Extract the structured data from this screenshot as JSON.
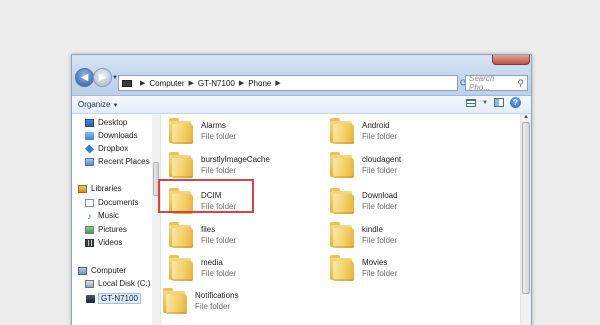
{
  "window": {
    "address_path": [
      "Computer",
      "GT-N7100",
      "Phone"
    ],
    "search_placeholder": "Search Pho..."
  },
  "toolbar": {
    "organize_label": "Organize"
  },
  "nav": {
    "favorites": [
      "Desktop",
      "Downloads",
      "Dropbox",
      "Recent Places"
    ],
    "libraries_header": "Libraries",
    "libraries": [
      "Documents",
      "Music",
      "Pictures",
      "Videos"
    ],
    "computer_header": "Computer",
    "computer_items": [
      "Local Disk (C:)",
      "GT-N7100"
    ]
  },
  "folders": [
    {
      "name": "Alarms",
      "type": "File folder"
    },
    {
      "name": "Android",
      "type": "File folder"
    },
    {
      "name": "burstlyImageCache",
      "type": "File folder"
    },
    {
      "name": "cloudagent",
      "type": "File folder"
    },
    {
      "name": "DCIM",
      "type": "File folder"
    },
    {
      "name": "Download",
      "type": "File folder"
    },
    {
      "name": "files",
      "type": "File folder"
    },
    {
      "name": "kindle",
      "type": "File folder"
    },
    {
      "name": "media",
      "type": "File folder"
    },
    {
      "name": "Movies",
      "type": "File folder"
    },
    {
      "name": "Notifications",
      "type": "File folder"
    }
  ],
  "colors": {
    "highlight": "#d64545",
    "folder": "#f2cd63"
  }
}
